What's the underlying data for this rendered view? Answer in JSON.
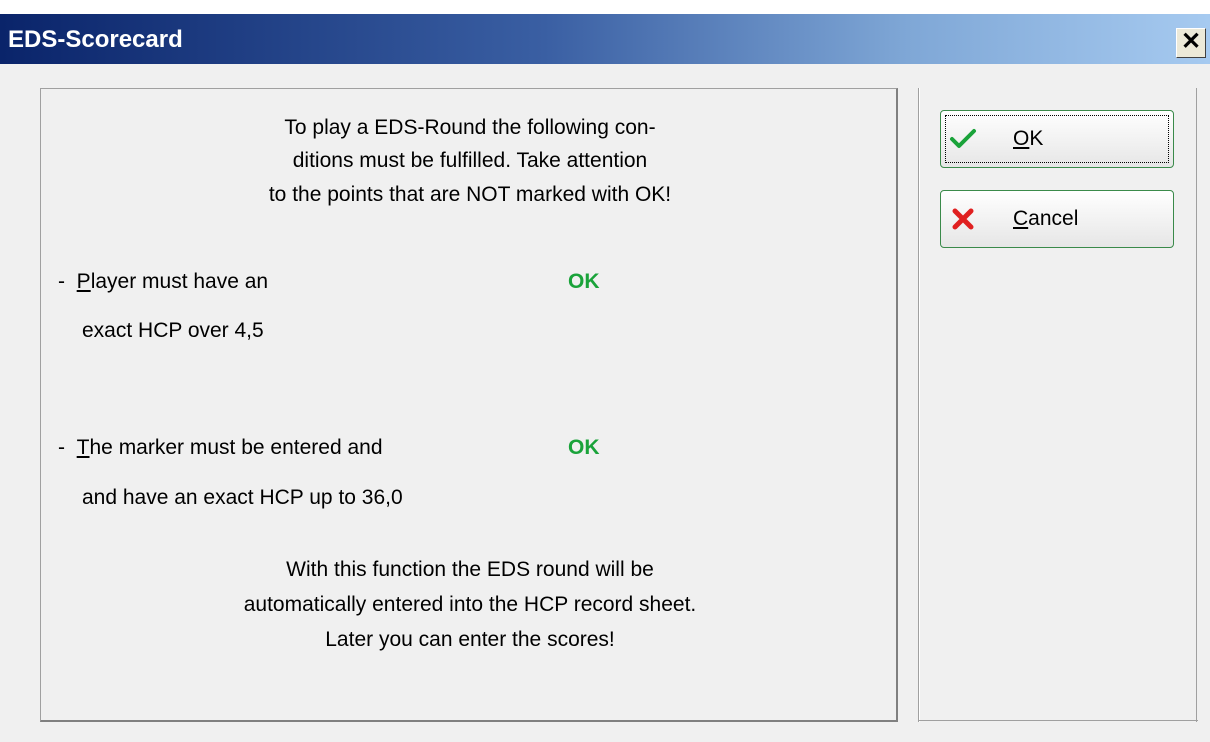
{
  "window": {
    "title": "EDS-Scorecard"
  },
  "intro": [
    "To play a EDS-Round the following con-",
    "ditions must be fulfilled. Take attention",
    "to the points that are NOT marked with OK!"
  ],
  "conditions": [
    {
      "dash": "-",
      "accel": "P",
      "line1_rest": "layer must have an",
      "line2": "exact HCP over 4,5",
      "status": "OK"
    },
    {
      "dash": "-",
      "accel": "T",
      "line1_rest": "he marker must be entered and",
      "line2": "and have an exact HCP up to 36,0",
      "status": "OK"
    }
  ],
  "footer": [
    "With this function the EDS round will be",
    "automatically entered into the HCP record sheet.",
    "Later you can enter the scores!"
  ],
  "buttons": {
    "ok": {
      "accel": "O",
      "rest": "K",
      "icon": "checkmark-icon"
    },
    "cancel": {
      "accel": "C",
      "rest": "ancel",
      "icon": "x-cross-icon"
    }
  },
  "colors": {
    "ok_green": "#1aa33a",
    "title_dark": "#0a246a",
    "title_light": "#a6caf0"
  }
}
